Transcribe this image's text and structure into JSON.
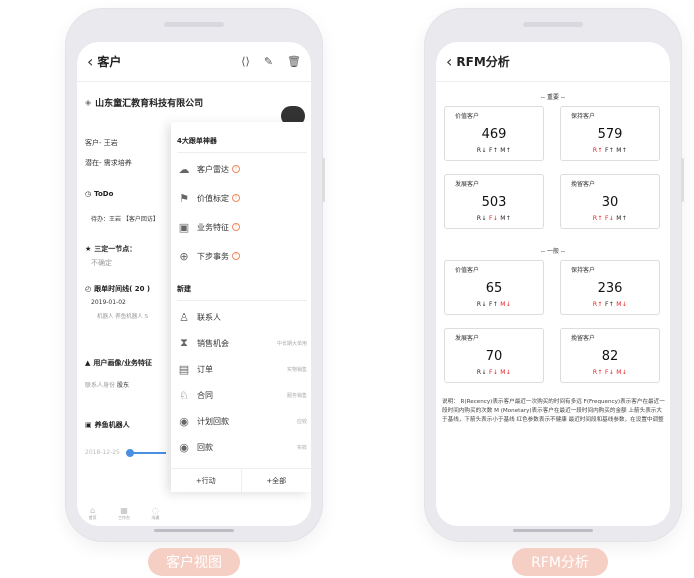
{
  "left_phone": {
    "header": {
      "back": "‹",
      "title": "客户"
    },
    "company": "山东童汇教育科技有限公司",
    "customer_row": "客户- 王岩",
    "potential_row": "潜在- 需求培养",
    "todo": {
      "title": "ToDo",
      "item": "待办：王岩 【客户回访】"
    },
    "next_node": {
      "title": "三定一节点：",
      "value": "不确定"
    },
    "tracking": {
      "title": "跟单时间线( 20 )",
      "date": "2019-01-02",
      "detail": "机器人 养鱼机器人 S"
    },
    "profile": {
      "title": "用户画像/业务特征",
      "key": "联系人身份",
      "value": "股东"
    },
    "product": {
      "title": "养鱼机器人",
      "date": "2018-12-25"
    },
    "tabbar": [
      "首页",
      "工作台",
      "沟通"
    ],
    "popup": {
      "section1_title": "4大跟单神器",
      "section1_items": [
        {
          "label": "客户雷达",
          "icon": "cloud-icon"
        },
        {
          "label": "价值标定",
          "icon": "flag-icon"
        },
        {
          "label": "业务特征",
          "icon": "cube-icon"
        },
        {
          "label": "下步事务",
          "icon": "target-icon"
        }
      ],
      "section2_title": "新建",
      "section2_items": [
        {
          "label": "联系人",
          "note": "",
          "icon": "person-icon"
        },
        {
          "label": "销售机会",
          "note": "中长期大单用",
          "icon": "hourglass-icon"
        },
        {
          "label": "订单",
          "note": "实物销售",
          "icon": "document-icon"
        },
        {
          "label": "合同",
          "note": "服务销售",
          "icon": "contract-icon"
        },
        {
          "label": "计划回款",
          "note": "应收",
          "icon": "payment-plan-icon"
        },
        {
          "label": "回款",
          "note": "实收",
          "icon": "payment-icon"
        }
      ],
      "footer_left": "+行动",
      "footer_right": "+全部"
    }
  },
  "right_phone": {
    "header": {
      "back": "‹",
      "title": "RFM分析"
    },
    "group1_label": "-- 重要 --",
    "group2_label": "-- 一般 --",
    "cards": [
      {
        "label": "价值客户",
        "value": "469",
        "r": "R↓",
        "f": "F↑",
        "m": "M↑"
      },
      {
        "label": "保持客户",
        "value": "579",
        "r": "R↑",
        "f": "F↑",
        "m": "M↑"
      },
      {
        "label": "发展客户",
        "value": "503",
        "r": "R↓",
        "f": "F↓",
        "m": "M↑"
      },
      {
        "label": "挽留客户",
        "value": "30",
        "r": "R↑",
        "f": "F↓",
        "m": "M↑"
      },
      {
        "label": "价值客户",
        "value": "65",
        "r": "R↓",
        "f": "F↑",
        "m": "M↓"
      },
      {
        "label": "保持客户",
        "value": "236",
        "r": "R↑",
        "f": "F↑",
        "m": "M↓"
      },
      {
        "label": "发展客户",
        "value": "70",
        "r": "R↓",
        "f": "F↓",
        "m": "M↓"
      },
      {
        "label": "挽留客户",
        "value": "82",
        "r": "R↑",
        "f": "F↓",
        "m": "M↓"
      }
    ],
    "note": "说明： R(Recency)表示客户最近一次购买的时间有多远 F(Frequency)表示客户在最近一段时间内购买的次数 M (Monetary)表示客户在最近一段时间内购买的金额 上箭头表示大于基线，下箭头表示小于基线 红色参数表示不健康 最近时间段和基线参数，在设置中调整"
  },
  "captions": {
    "left": "客户视图",
    "right": "RFM分析"
  },
  "colors": {
    "warn_red": "#e02020",
    "caption_bg": "#f6cfc4",
    "accent_blue": "#4a90e2"
  }
}
